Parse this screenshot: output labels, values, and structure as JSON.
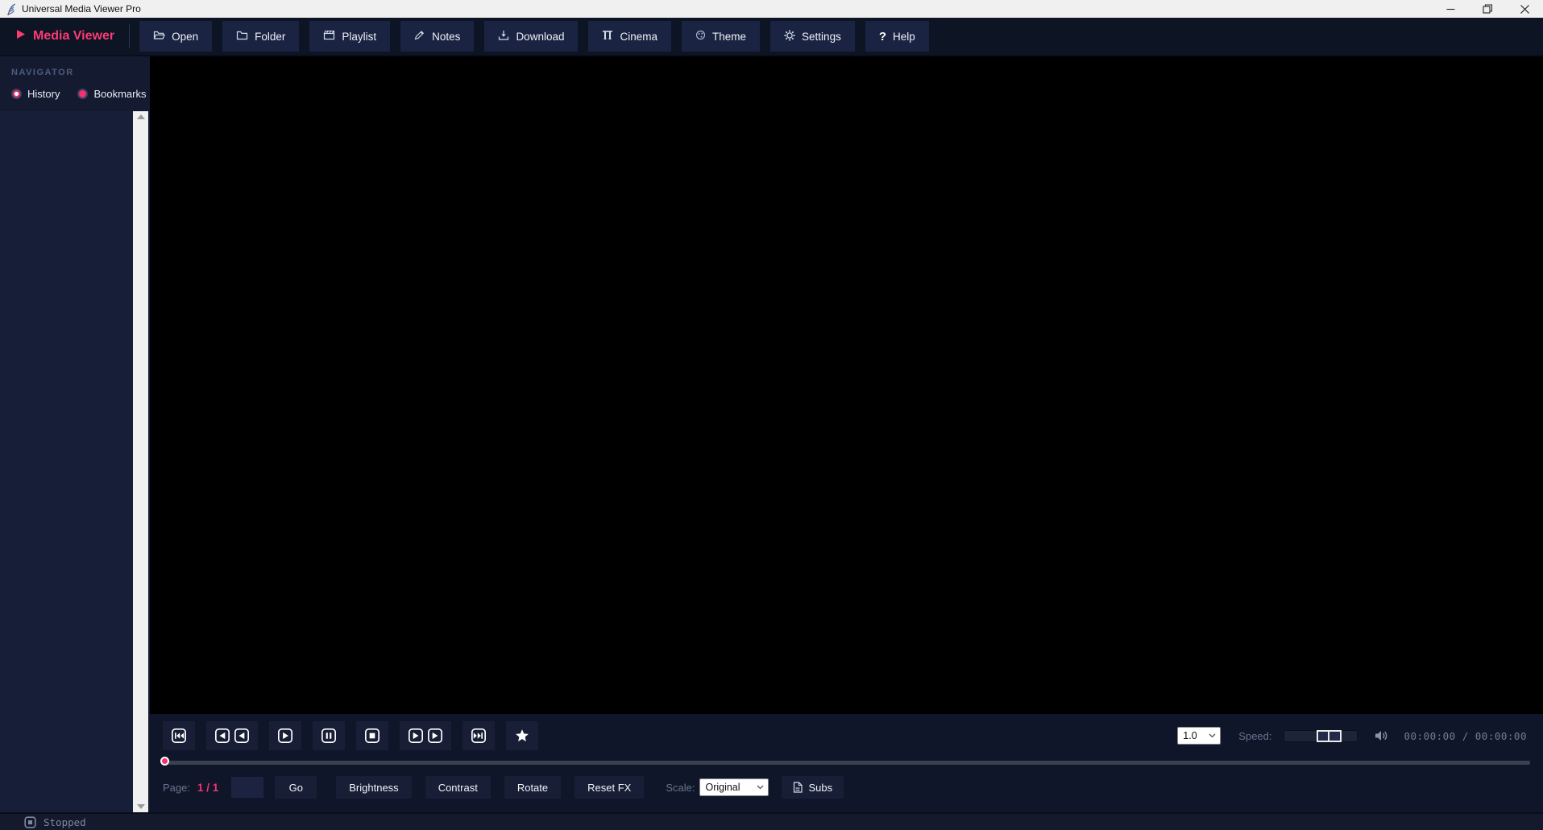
{
  "window": {
    "title": "Universal Media Viewer Pro",
    "app_icon": "feather-app-icon",
    "controls": [
      "minimize",
      "maximize-restore",
      "close"
    ]
  },
  "toolbar": {
    "brand": {
      "icon": "play-icon",
      "label": "Media Viewer"
    },
    "buttons": [
      {
        "icon": "open-folder-icon",
        "label": "Open"
      },
      {
        "icon": "folder-icon",
        "label": "Folder"
      },
      {
        "icon": "clapperboard-icon",
        "label": "Playlist"
      },
      {
        "icon": "pen-icon",
        "label": "Notes"
      },
      {
        "icon": "download-tray-icon",
        "label": "Download"
      },
      {
        "icon": "film-strip-icon",
        "label": "Cinema"
      },
      {
        "icon": "theme-sphere-icon",
        "label": "Theme"
      },
      {
        "icon": "gear-icon",
        "label": "Settings"
      },
      {
        "icon": "question-icon",
        "label": "Help"
      }
    ]
  },
  "sidebar": {
    "header": "NAVIGATOR",
    "tabs": [
      {
        "label": "History",
        "selected": true
      },
      {
        "label": "Bookmarks",
        "selected": false
      }
    ],
    "list_items": []
  },
  "player": {
    "playback_buttons": [
      "skip-start-icon",
      "rewind-icon",
      "play-icon",
      "pause-icon",
      "stop-icon",
      "fast-forward-icon",
      "skip-end-icon",
      "star-icon"
    ],
    "speed_value": "1.0",
    "speed_label": "Speed:",
    "volume_icon": "speaker-icon",
    "time_display": "00:00:00 / 00:00:00",
    "seek_percent": 0
  },
  "pagebar": {
    "page_label": "Page:",
    "page_value": "1 / 1",
    "page_input": "",
    "go_label": "Go",
    "fx_buttons": [
      "Brightness",
      "Contrast",
      "Rotate",
      "Reset FX"
    ],
    "scale_label": "Scale:",
    "scale_value": "Original",
    "subs_label": "Subs"
  },
  "statusbar": {
    "icon": "stop-icon",
    "text": "Stopped"
  },
  "colors": {
    "accent_pink": "#f83073",
    "titlebar_bg": "#f0f0f0",
    "toolbar_bg": "#0d1424",
    "panel_bg": "#141b31",
    "button_bg": "#1a2342",
    "canvas_bg": "#000000",
    "muted_text": "#66738f",
    "scrollbar_bg": "#f0f0f0"
  }
}
